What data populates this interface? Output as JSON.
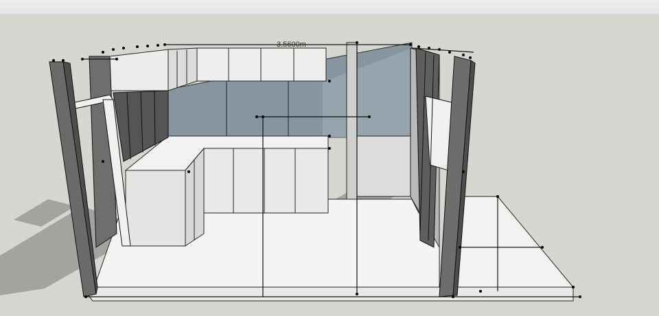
{
  "viewport": {
    "dimension_label": "3.5600m",
    "colors": {
      "background": "#d7d7d2",
      "floor": "#f4f4f2",
      "wall_dark": "#6c6c6c",
      "glass": "#7f93a0",
      "shadow": "#9e9e9c",
      "cabinet": "#e6e6e6",
      "edge": "#111111"
    }
  }
}
